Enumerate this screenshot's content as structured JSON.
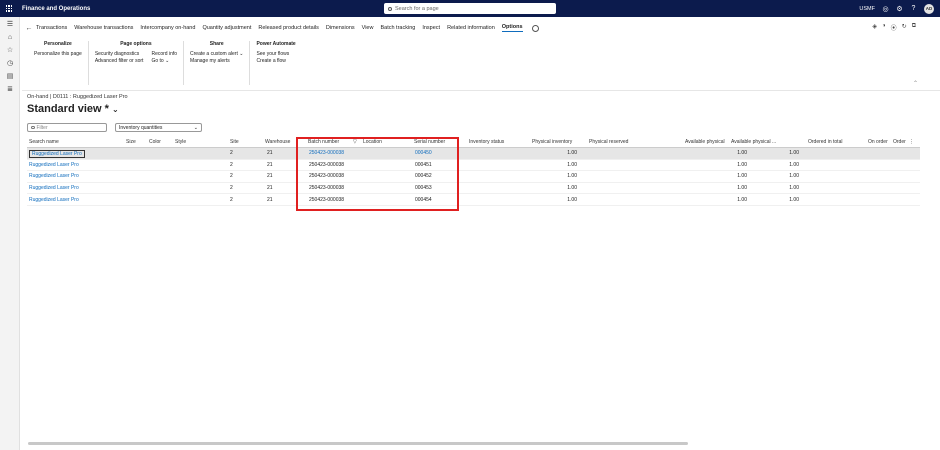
{
  "app": {
    "title": "Finance and Operations",
    "search_placeholder": "Search for a page",
    "company": "USMF",
    "avatar_initials": "AD"
  },
  "actionpane": {
    "tabs": [
      {
        "label": "Transactions"
      },
      {
        "label": "Warehouse transactions"
      },
      {
        "label": "Intercompany on-hand"
      },
      {
        "label": "Quantity adjustment"
      },
      {
        "label": "Released product details"
      },
      {
        "label": "Dimensions"
      },
      {
        "label": "View"
      },
      {
        "label": "Batch tracking"
      },
      {
        "label": "Inspect"
      },
      {
        "label": "Related information"
      },
      {
        "label": "Options",
        "active": true
      }
    ],
    "groups": {
      "personalize": {
        "title": "Personalize",
        "items": [
          "Personalize this page"
        ]
      },
      "page_options": {
        "title": "Page options",
        "col1": [
          "Security diagnostics",
          "Advanced filter or sort"
        ],
        "col2": [
          "Record info",
          "Go to"
        ]
      },
      "share": {
        "title": "Share",
        "items": [
          "Create a custom alert",
          "Manage my alerts"
        ]
      },
      "power_automate": {
        "title": "Power Automate",
        "items": [
          "See your flows",
          "Create a flow"
        ]
      }
    }
  },
  "page": {
    "breadcrumb": "On-hand  |  D0111 : Ruggedized Laser Pro",
    "view_title": "Standard view *",
    "filter_placeholder": "Filter",
    "quantity_select": "Inventory quantities"
  },
  "grid": {
    "columns": [
      "Search name",
      "Size",
      "Color",
      "Style",
      "Site",
      "Warehouse",
      "Batch number",
      "Location",
      "Serial number",
      "Inventory status",
      "Physical inventory",
      "Physical reserved",
      "Available physical",
      "Available physical ...",
      "Ordered in total",
      "On order",
      "Order"
    ],
    "rows": [
      {
        "search_name": "Ruggedized Laser Pro",
        "site": "2",
        "warehouse": "21",
        "batch": "250423-000038",
        "serial": "000450",
        "phys_inv": "1.00",
        "avail_phys": "1.00",
        "avail_phys2": "1.00"
      },
      {
        "search_name": "Ruggedized Laser Pro",
        "site": "2",
        "warehouse": "21",
        "batch": "250423-000038",
        "serial": "000451",
        "phys_inv": "1.00",
        "avail_phys": "1.00",
        "avail_phys2": "1.00"
      },
      {
        "search_name": "Ruggedized Laser Pro",
        "site": "2",
        "warehouse": "21",
        "batch": "250423-000038",
        "serial": "000452",
        "phys_inv": "1.00",
        "avail_phys": "1.00",
        "avail_phys2": "1.00"
      },
      {
        "search_name": "Ruggedized Laser Pro",
        "site": "2",
        "warehouse": "21",
        "batch": "250423-000038",
        "serial": "000453",
        "phys_inv": "1.00",
        "avail_phys": "1.00",
        "avail_phys2": "1.00"
      },
      {
        "search_name": "Ruggedized Laser Pro",
        "site": "2",
        "warehouse": "21",
        "batch": "250423-000038",
        "serial": "000454",
        "phys_inv": "1.00",
        "avail_phys": "1.00",
        "avail_phys2": "1.00"
      }
    ]
  },
  "colors": {
    "topbar": "#0c1b4d",
    "link": "#0f6cbd",
    "highlight": "#e02020"
  }
}
